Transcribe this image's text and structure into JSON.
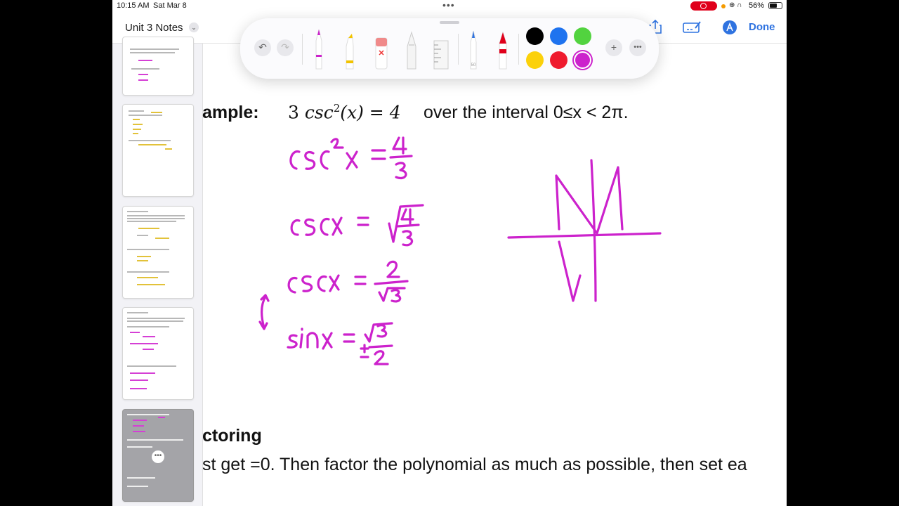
{
  "status": {
    "time": "10:15 AM",
    "date": "Sat Mar 8",
    "battery": "56%",
    "battery_level": 0.56
  },
  "document": {
    "title": "Unit 3 Notes",
    "done_label": "Done"
  },
  "toolbar": {
    "undo_icon": "undo-icon",
    "redo_icon": "redo-icon",
    "tools": [
      "pen",
      "marker",
      "eraser",
      "pencil",
      "ruler",
      "fountain-pen",
      "crayon"
    ],
    "tool_width_label": "50",
    "colors": [
      "#000000",
      "#1f73ef",
      "#52d33f",
      "#fbd10b",
      "#ef1b2e",
      "#cc22cc"
    ],
    "selected_color": "#cc22cc"
  },
  "sidebar": {
    "page_count": 5,
    "selected_index": 4
  },
  "content": {
    "example_label": "ample:",
    "equation_coef": "3 ",
    "equation_fn": "csc",
    "equation_exp": "2",
    "equation_arg": "(x) = 4",
    "equation_tail": "over the interval 0≤x < 2π.",
    "section_title": "ctoring",
    "body_text": "st get =0. Then factor the polynomial as much as possible, then set ea"
  },
  "handwriting": {
    "color": "#cc22cc",
    "lines": [
      "csc²x = 4/3",
      "cscx = √(4/3)",
      "cscx = 2/√3",
      "sinx = ±√3/2"
    ]
  }
}
